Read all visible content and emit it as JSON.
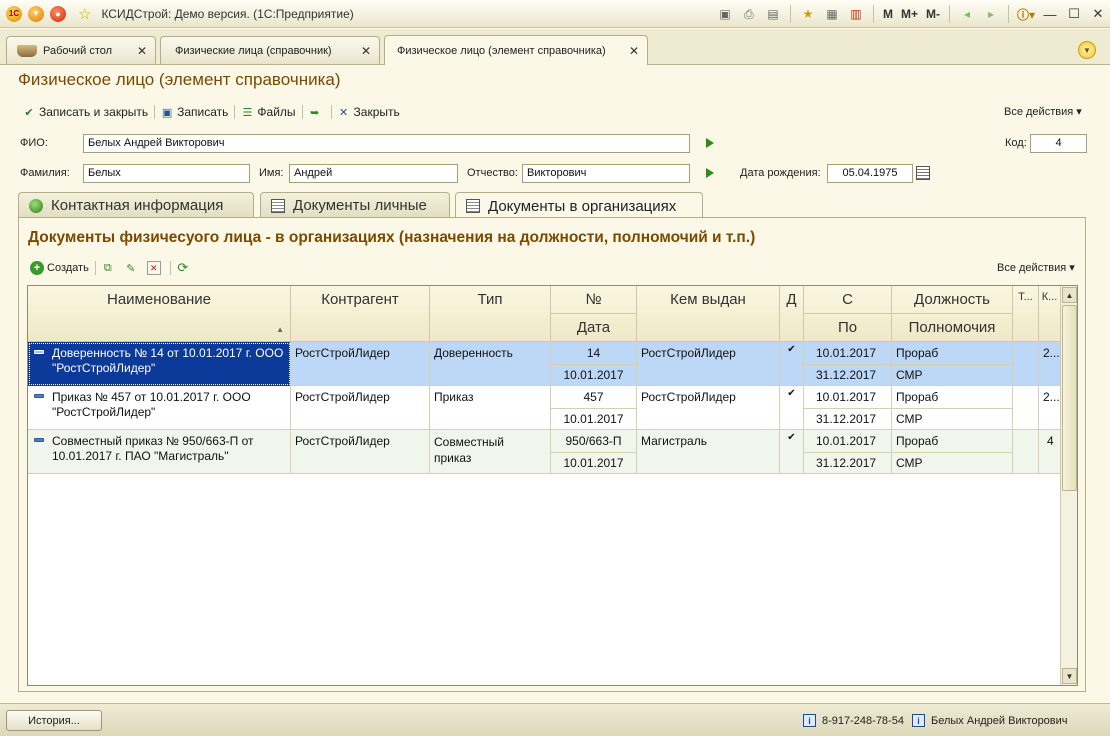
{
  "window": {
    "title": "КСИДСтрой: Демо версия.  (1С:Предприятие)",
    "memory_buttons": [
      "M",
      "M+",
      "M-"
    ]
  },
  "tabs": [
    {
      "label": "Рабочий стол",
      "active": false
    },
    {
      "label": "Физические лица (справочник)",
      "active": false
    },
    {
      "label": "Физическое лицо (элемент справочника)",
      "active": true
    }
  ],
  "form": {
    "title": "Физическое лицо (элемент справочника)",
    "toolbar": {
      "save_close": "Записать и закрыть",
      "save": "Записать",
      "files": "Файлы",
      "close": "Закрыть",
      "all_actions": "Все действия"
    },
    "fields": {
      "fio_label": "ФИО:",
      "fio_value": "Белых Андрей Викторович",
      "code_label": "Код:",
      "code_value": "4",
      "lastname_label": "Фамилия:",
      "lastname_value": "Белых",
      "firstname_label": "Имя:",
      "firstname_value": "Андрей",
      "middlename_label": "Отчество:",
      "middlename_value": "Викторович",
      "birthdate_label": "Дата рождения:",
      "birthdate_value": "05.04.1975"
    }
  },
  "inner_tabs": [
    {
      "label": "Контактная информация",
      "active": false
    },
    {
      "label": "Документы личные",
      "active": false
    },
    {
      "label": "Документы в организациях",
      "active": true
    }
  ],
  "section": {
    "title": "Документы физичесуого лица - в организациях (назначения на должности, полномочий и т.п.)",
    "toolbar": {
      "create": "Создать",
      "all_actions": "Все действия"
    }
  },
  "table": {
    "headers": {
      "name": "Наименование",
      "counterparty": "Контрагент",
      "type": "Тип",
      "number": "№",
      "date": "Дата",
      "issued_by": "Кем выдан",
      "d": "Д",
      "from": "С",
      "to": "По",
      "position": "Должность",
      "powers": "Полномочия",
      "col_t": "Т...",
      "col_k": "К..."
    },
    "rows": [
      {
        "name": "Доверенность № 14 от 10.01.2017 г. ООО \"РостСтройЛидер\"",
        "counterparty": "РостСтройЛидер",
        "type": "Доверенность",
        "number": "14",
        "date": "10.01.2017",
        "issued_by": "РостСтройЛидер",
        "d": "✔",
        "from": "10.01.2017",
        "to": "31.12.2017",
        "position": "Прораб",
        "powers": "СМР",
        "col_t": "",
        "col_k": "2...",
        "selected": true
      },
      {
        "name": "Приказ № 457 от 10.01.2017 г. ООО \"РостСтройЛидер\"",
        "counterparty": "РостСтройЛидер",
        "type": "Приказ",
        "number": "457",
        "date": "10.01.2017",
        "issued_by": "РостСтройЛидер",
        "d": "✔",
        "from": "10.01.2017",
        "to": "31.12.2017",
        "position": "Прораб",
        "powers": "СМР",
        "col_t": "",
        "col_k": "2...",
        "selected": false
      },
      {
        "name": "Совместный приказ № 950/663-П от 10.01.2017 г. ПАО \"Магистраль\"",
        "counterparty": "РостСтройЛидер",
        "type": "Совместный приказ",
        "number": "950/663-П",
        "date": "10.01.2017",
        "issued_by": "Магистраль",
        "d": "✔",
        "from": "10.01.2017",
        "to": "31.12.2017",
        "position": "Прораб",
        "powers": "СМР",
        "col_t": "",
        "col_k": "4",
        "selected": false
      }
    ]
  },
  "statusbar": {
    "history": "История...",
    "phone": "8-917-248-78-54",
    "user": "Белых Андрей Викторович"
  },
  "colors": {
    "accent_title": "#7a4a00",
    "selection": "#0b3a9a",
    "row_selected": "#bcd8f6",
    "background": "#fbf8e8"
  }
}
